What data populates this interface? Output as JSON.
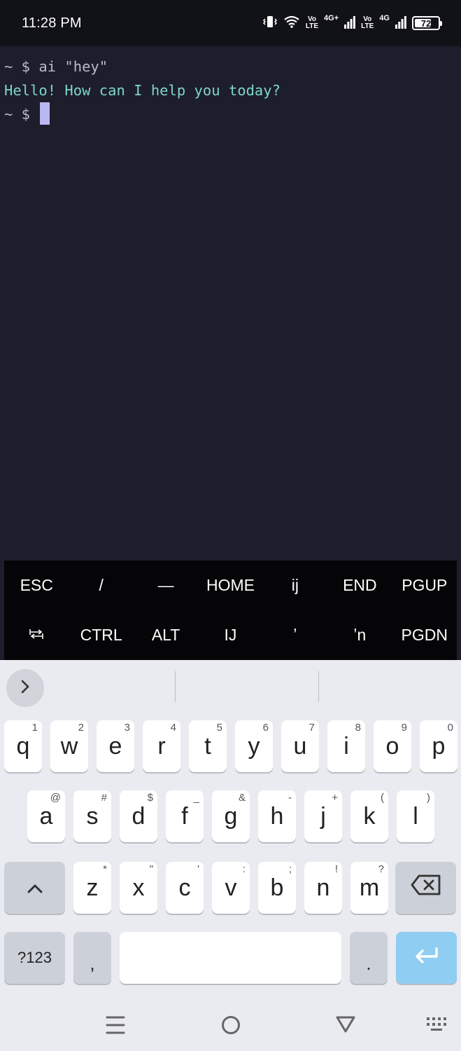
{
  "status_bar": {
    "time": "11:28 PM",
    "sim1_label_top": "Vo",
    "sim1_label_bottom": "LTE",
    "sim1_net": "4G+",
    "sim2_label_top": "Vo",
    "sim2_label_bottom": "LTE",
    "sim2_net": "4G",
    "battery": "72",
    "battery_level": 0.72,
    "icons": [
      "vibrate-icon",
      "wifi-icon",
      "signal-icon",
      "battery-icon"
    ]
  },
  "terminal": {
    "lines": [
      {
        "prompt": "~ $",
        "text": " ai \"hey\""
      },
      {
        "prompt": "",
        "text": "Hello! How can I help you today?"
      },
      {
        "prompt": "~ $",
        "text": " "
      }
    ],
    "colors": {
      "background": "#1d1d2b",
      "output": "#7ed6c6",
      "prompt": "#b7bcc9",
      "cursor": "#b9b8f2"
    }
  },
  "extra_keys": {
    "row1": [
      "ESC",
      "/",
      "—",
      "HOME",
      "ij",
      "END",
      "PGUP"
    ],
    "row2": [
      "⭾",
      "CTRL",
      "ALT",
      "IJ",
      "ʼ",
      "ʼn",
      "PGDN"
    ]
  },
  "keyboard": {
    "row1": [
      {
        "key": "q",
        "hint": "1"
      },
      {
        "key": "w",
        "hint": "2"
      },
      {
        "key": "e",
        "hint": "3"
      },
      {
        "key": "r",
        "hint": "4"
      },
      {
        "key": "t",
        "hint": "5"
      },
      {
        "key": "y",
        "hint": "6"
      },
      {
        "key": "u",
        "hint": "7"
      },
      {
        "key": "i",
        "hint": "8"
      },
      {
        "key": "o",
        "hint": "9"
      },
      {
        "key": "p",
        "hint": "0"
      }
    ],
    "row2": [
      {
        "key": "a",
        "hint": "@"
      },
      {
        "key": "s",
        "hint": "#"
      },
      {
        "key": "d",
        "hint": "$"
      },
      {
        "key": "f",
        "hint": "_"
      },
      {
        "key": "g",
        "hint": "&"
      },
      {
        "key": "h",
        "hint": "-"
      },
      {
        "key": "j",
        "hint": "+"
      },
      {
        "key": "k",
        "hint": "("
      },
      {
        "key": "l",
        "hint": ")"
      }
    ],
    "row3": [
      {
        "key": "z",
        "hint": "*"
      },
      {
        "key": "x",
        "hint": "\""
      },
      {
        "key": "c",
        "hint": "'"
      },
      {
        "key": "v",
        "hint": ":"
      },
      {
        "key": "b",
        "hint": ";"
      },
      {
        "key": "n",
        "hint": "!"
      },
      {
        "key": "m",
        "hint": "?"
      }
    ],
    "symbols_label": "?123",
    "comma_label": ",",
    "period_label": ".",
    "enter_color": "#8fcdf2"
  }
}
